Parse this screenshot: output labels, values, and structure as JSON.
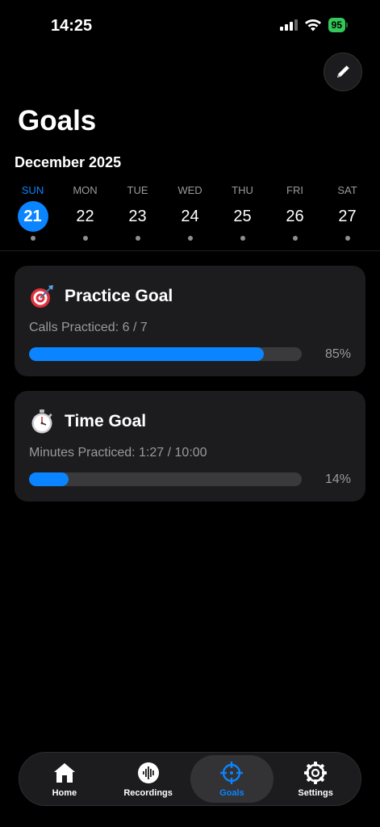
{
  "status_bar": {
    "time": "14:25",
    "battery": "95"
  },
  "page": {
    "title": "Goals",
    "month": "December 2025"
  },
  "week": [
    {
      "name": "SUN",
      "num": "21",
      "selected": true
    },
    {
      "name": "MON",
      "num": "22",
      "selected": false
    },
    {
      "name": "TUE",
      "num": "23",
      "selected": false
    },
    {
      "name": "WED",
      "num": "24",
      "selected": false
    },
    {
      "name": "THU",
      "num": "25",
      "selected": false
    },
    {
      "name": "FRI",
      "num": "26",
      "selected": false
    },
    {
      "name": "SAT",
      "num": "27",
      "selected": false
    }
  ],
  "goals": [
    {
      "icon": "dart-target-icon",
      "title": "Practice Goal",
      "subtitle": "Calls Practiced: 6 / 7",
      "progress": 0.86,
      "percent_label": "85%"
    },
    {
      "icon": "stopwatch-icon",
      "title": "Time Goal",
      "subtitle": "Minutes Practiced: 1:27 / 10:00",
      "progress": 0.145,
      "percent_label": "14%"
    }
  ],
  "tabs": [
    {
      "icon": "home-icon",
      "label": "Home",
      "active": false
    },
    {
      "icon": "waveform-icon",
      "label": "Recordings",
      "active": false
    },
    {
      "icon": "crosshair-icon",
      "label": "Goals",
      "active": true
    },
    {
      "icon": "gear-icon",
      "label": "Settings",
      "active": false
    }
  ],
  "colors": {
    "accent": "#0a84ff",
    "battery": "#34c759",
    "card": "#1c1c1e"
  }
}
